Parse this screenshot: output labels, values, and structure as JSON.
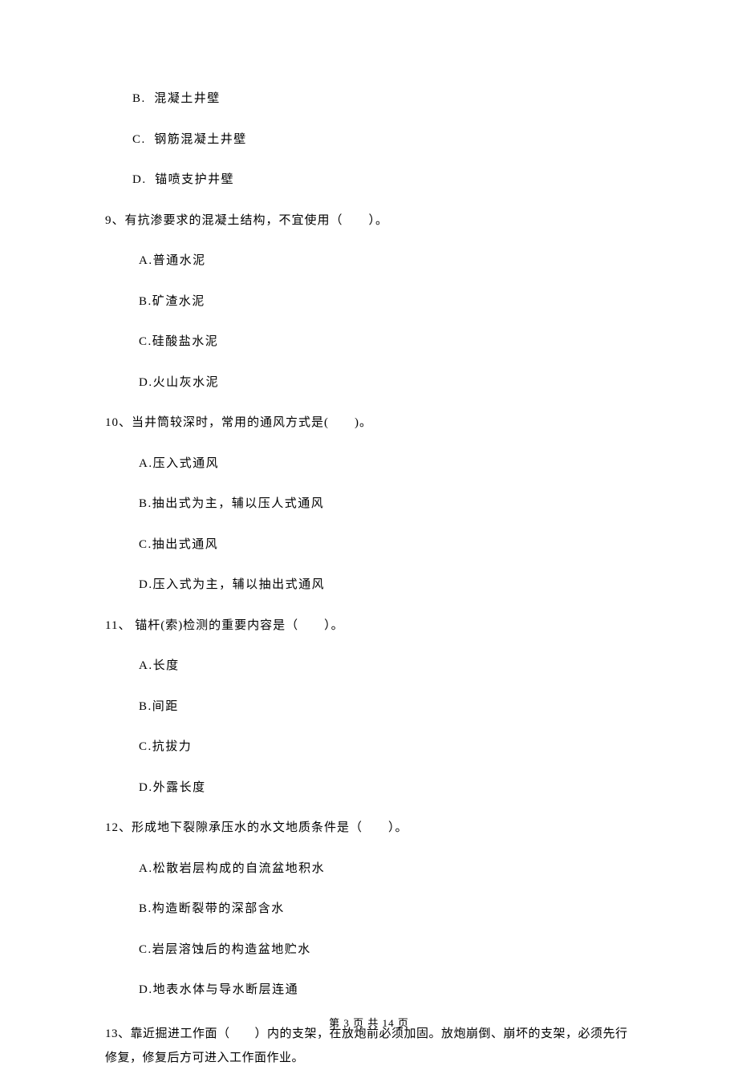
{
  "q8_continued": {
    "b": "B.  混凝土井壁",
    "c": "C.  钢筋混凝土井壁",
    "d": "D.  锚喷支护井壁"
  },
  "q9": {
    "stem": "9、有抗渗要求的混凝土结构，不宜使用（　　）。",
    "a": "A.普通水泥",
    "b": "B.矿渣水泥",
    "c": "C.硅酸盐水泥",
    "d": "D.火山灰水泥"
  },
  "q10": {
    "stem": "10、当井筒较深时，常用的通风方式是(　　)。",
    "a": "A.压入式通风",
    "b": "B.抽出式为主，辅以压人式通风",
    "c": "C.抽出式通风",
    "d": "D.压入式为主，辅以抽出式通风"
  },
  "q11": {
    "stem": "11、 锚杆(索)检测的重要内容是（　　）。",
    "a": "A.长度",
    "b": "B.间距",
    "c": "C.抗拔力",
    "d": "D.外露长度"
  },
  "q12": {
    "stem": "12、形成地下裂隙承压水的水文地质条件是（　　）。",
    "a": "A.松散岩层构成的自流盆地积水",
    "b": "B.构造断裂带的深部含水",
    "c": "C.岩层溶蚀后的构造盆地贮水",
    "d": "D.地表水体与导水断层连通"
  },
  "q13": {
    "stem": "13、靠近掘进工作面（　　）内的支架，在放炮前必须加固。放炮崩倒、崩坏的支架，必须先行修复，修复后方可进入工作面作业。"
  },
  "footer": "第 3 页 共 14 页"
}
